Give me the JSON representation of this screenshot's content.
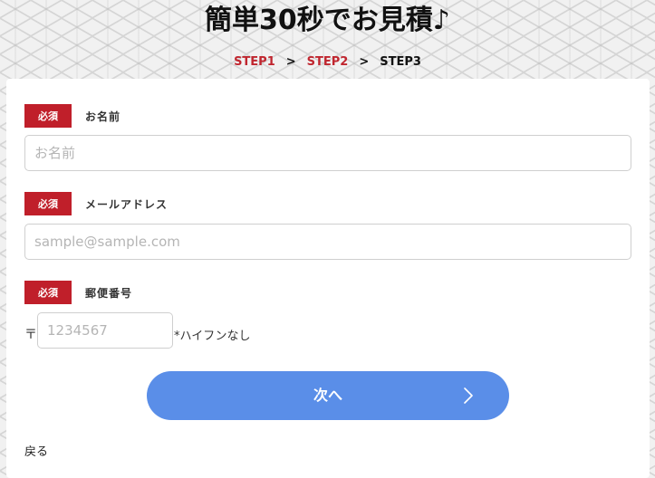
{
  "page": {
    "title": "簡単30秒でお見積♪"
  },
  "steps": {
    "step1": "STEP1",
    "sep1": ">",
    "step2": "STEP2",
    "sep2": ">",
    "step3": "STEP3"
  },
  "form": {
    "name": {
      "badge": "必須",
      "label": "お名前",
      "placeholder": "お名前",
      "value": ""
    },
    "email": {
      "badge": "必須",
      "label": "メールアドレス",
      "placeholder": "sample@sample.com",
      "value": ""
    },
    "zip": {
      "badge": "必須",
      "label": "郵便番号",
      "mark": "〒",
      "placeholder": "1234567",
      "value": "",
      "note": "*ハイフンなし"
    }
  },
  "actions": {
    "next_label": "次へ",
    "back_label": "戻る"
  },
  "colors": {
    "required_badge": "#c01f2a",
    "step_done": "#c0262f",
    "primary_button": "#5a8ee8"
  },
  "icons": {
    "next_button_icon": "chevron-right-icon"
  }
}
